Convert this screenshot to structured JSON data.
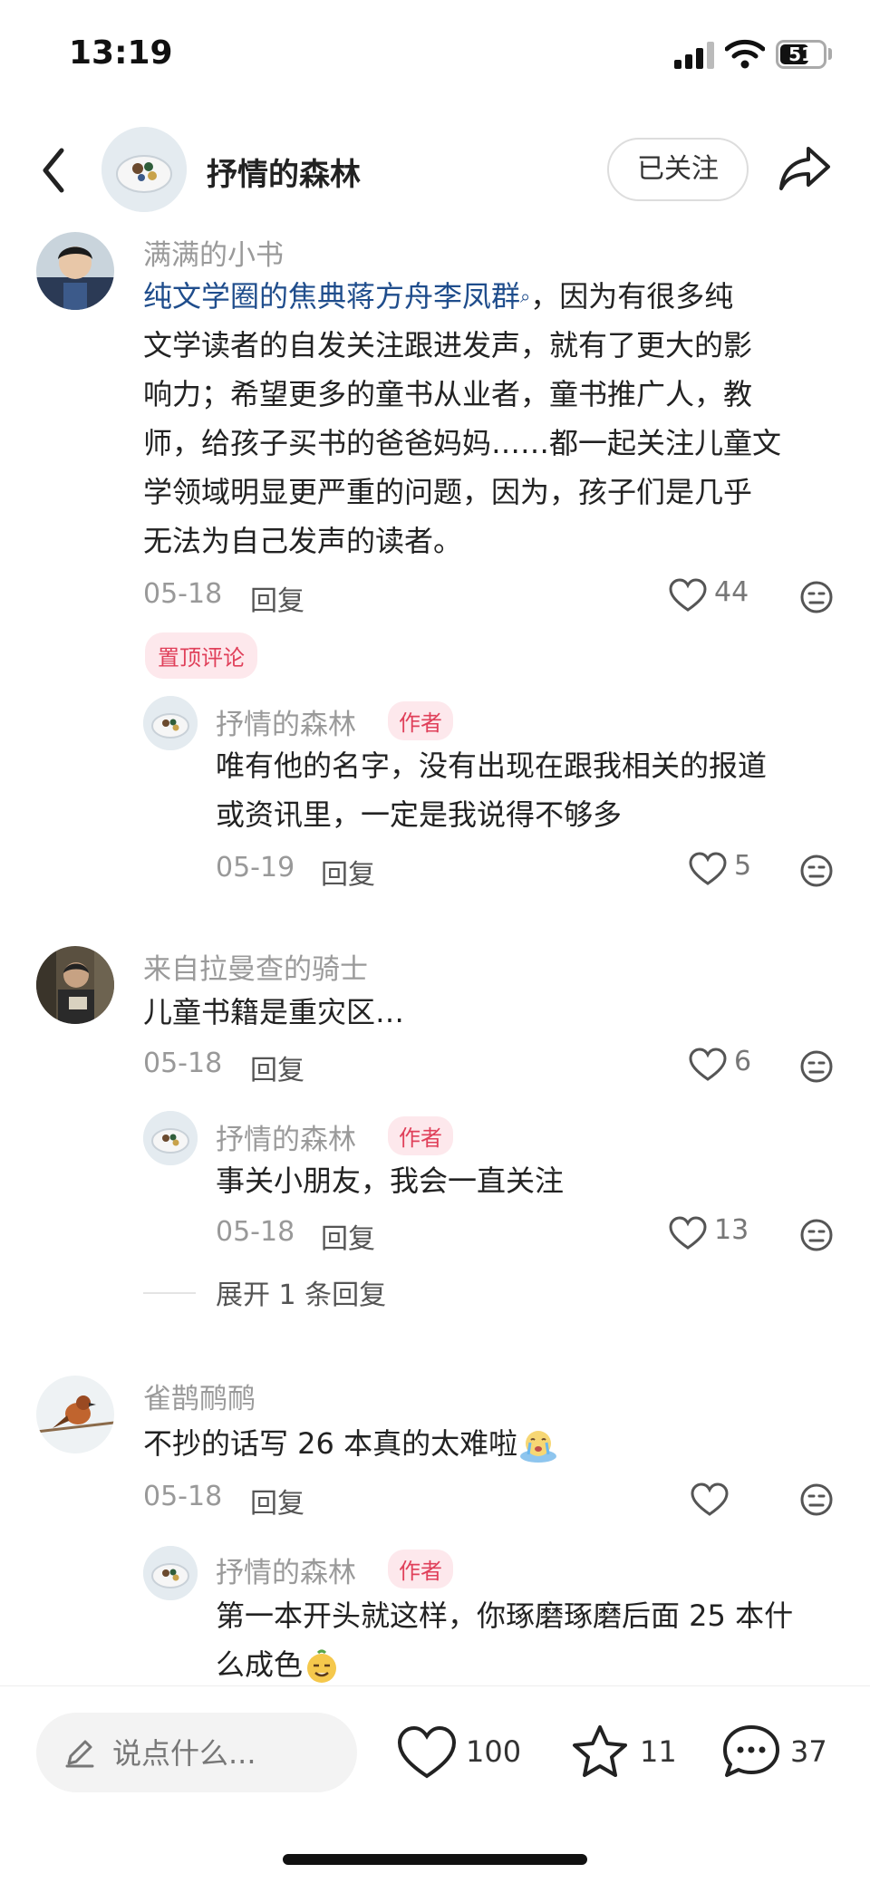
{
  "status_bar": {
    "time": "13:19",
    "battery": "51"
  },
  "header": {
    "title": "抒情的森林",
    "follow_label": "已关注"
  },
  "comments": [
    {
      "username": "满满的小书",
      "content_link": "纯文学圈的焦典蒋方舟李凤群",
      "content_lines": [
        "，因为有很多纯",
        "文学读者的自发关注跟进发声，就有了更大的影",
        "响力；希望更多的童书从业者，童书推广人，教",
        "师，给孩子买书的爸爸妈妈……都一起关注儿童文",
        "学领域明显更严重的问题，因为，孩子们是几乎",
        "无法为自己发声的读者。"
      ],
      "date": "05-18",
      "reply_label": "回复",
      "likes": "44",
      "pinned_label": "置顶评论",
      "replies": [
        {
          "username": "抒情的森林",
          "badge": "作者",
          "content_lines": [
            "唯有他的名字，没有出现在跟我相关的报道",
            "或资讯里，一定是我说得不够多"
          ],
          "date": "05-19",
          "reply_label": "回复",
          "likes": "5"
        }
      ]
    },
    {
      "username": "来自拉曼查的骑士",
      "content": "儿童书籍是重灾区…",
      "date": "05-18",
      "reply_label": "回复",
      "likes": "6",
      "replies": [
        {
          "username": "抒情的森林",
          "badge": "作者",
          "content": "事关小朋友，我会一直关注",
          "date": "05-18",
          "reply_label": "回复",
          "likes": "13"
        }
      ],
      "expand_label": "展开 1 条回复"
    },
    {
      "username": "雀鹊鸸鸸",
      "content": "不抄的话写 26 本真的太难啦",
      "date": "05-18",
      "reply_label": "回复",
      "likes": "",
      "replies": [
        {
          "username": "抒情的森林",
          "badge": "作者",
          "content_lines": [
            "第一本开头就这样，你琢磨琢磨后面 25 本什",
            "么成色"
          ]
        }
      ]
    }
  ],
  "bottom_bar": {
    "input_placeholder": "说点什么...",
    "likes": "100",
    "stars": "11",
    "comments": "37"
  },
  "icons": [
    "back-icon",
    "share-icon",
    "heart-icon",
    "dislike-icon",
    "star-icon",
    "comment-icon",
    "pencil-icon"
  ],
  "colors": {
    "link": "#1f4d8c",
    "badge_text": "#e0405a",
    "badge_bg": "#fde8ec"
  }
}
